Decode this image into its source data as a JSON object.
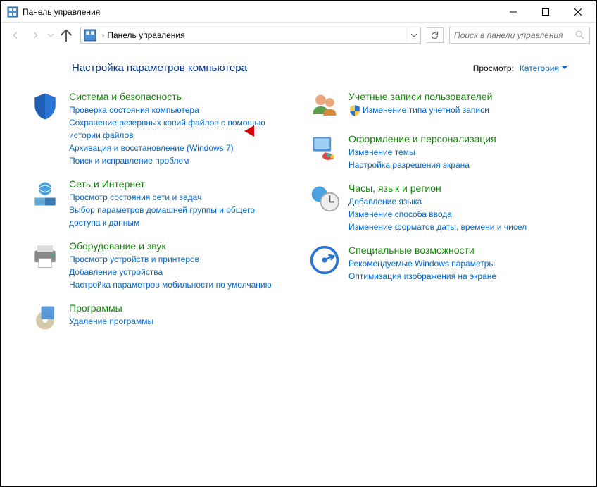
{
  "window": {
    "title": "Панель управления"
  },
  "address": {
    "path": "Панель управления"
  },
  "search": {
    "placeholder": "Поиск в панели управления"
  },
  "header": {
    "title": "Настройка параметров компьютера",
    "view_label": "Просмотр:",
    "view_value": "Категория"
  },
  "left": [
    {
      "title": "Система и безопасность",
      "links": [
        "Проверка состояния компьютера",
        "Сохранение резервных копий файлов с помощью истории файлов",
        "Архивация и восстановление (Windows 7)",
        "Поиск и исправление проблем"
      ]
    },
    {
      "title": "Сеть и Интернет",
      "links": [
        "Просмотр состояния сети и задач",
        "Выбор параметров домашней группы и общего доступа к данным"
      ]
    },
    {
      "title": "Оборудование и звук",
      "links": [
        "Просмотр устройств и принтеров",
        "Добавление устройства",
        "Настройка параметров мобильности по умолчанию"
      ]
    },
    {
      "title": "Программы",
      "links": [
        "Удаление программы"
      ]
    }
  ],
  "right": [
    {
      "title": "Учетные записи пользователей",
      "links": [
        "Изменение типа учетной записи"
      ],
      "shield": [
        true
      ]
    },
    {
      "title": "Оформление и персонализация",
      "links": [
        "Изменение темы",
        "Настройка разрешения экрана"
      ]
    },
    {
      "title": "Часы, язык и регион",
      "links": [
        "Добавление языка",
        "Изменение способа ввода",
        "Изменение форматов даты, времени и чисел"
      ]
    },
    {
      "title": "Специальные возможности",
      "links": [
        "Рекомендуемые Windows параметры",
        "Оптимизация изображения на экране"
      ]
    }
  ]
}
